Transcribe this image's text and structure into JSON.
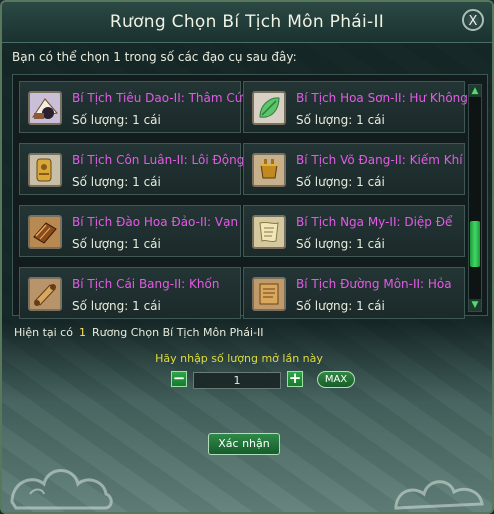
{
  "window": {
    "title": "Rương Chọn Bí Tịch Môn Phái-II",
    "close_label": "X"
  },
  "prompt": "Bạn có thể chọn 1 trong số các đạo cụ sau đây:",
  "items": [
    {
      "name": "Bí Tịch Tiêu Dao-II: Thâm Cứu",
      "qty": "Số lượng: 1 cái",
      "icon": "scroll-fan-icon"
    },
    {
      "name": "Bí Tịch Hoa Sơn-II: Hư Không",
      "qty": "Số lượng: 1 cái",
      "icon": "jade-leaf-icon"
    },
    {
      "name": "Bí Tịch Côn Luân-II: Lôi Động",
      "qty": "Số lượng: 1 cái",
      "icon": "golden-scroll-icon"
    },
    {
      "name": "Bí Tịch Võ Đang-II: Kiếm Khí",
      "qty": "Số lượng: 1 cái",
      "icon": "bronze-cauldron-icon"
    },
    {
      "name": "Bí Tịch Đào Hoa Đảo-II: Vạn",
      "qty": "Số lượng: 1 cái",
      "icon": "book-icon"
    },
    {
      "name": "Bí Tịch Nga My-II: Diệp Để",
      "qty": "Số lượng: 1 cái",
      "icon": "paper-scroll-icon"
    },
    {
      "name": "Bí Tịch Cái Bang-II: Khốn",
      "qty": "Số lượng: 1 cái",
      "icon": "rolled-scroll-icon"
    },
    {
      "name": "Bí Tịch Đường Môn-II: Hỏa",
      "qty": "Số lượng: 1 cái",
      "icon": "parchment-icon"
    }
  ],
  "status": {
    "prefix": "Hiện tại có",
    "count": "1",
    "item": "Rương Chọn Bí Tịch Môn Phái-II"
  },
  "quantity": {
    "label": "Hãy nhập số lượng mở lần này",
    "value": "1",
    "decrement": "−",
    "increment": "+",
    "max_label": "MAX"
  },
  "confirm_label": "Xác nhận",
  "scrollbar": {
    "up": "▲",
    "down": "▼",
    "position_fraction": 0.62
  },
  "colors": {
    "item_name": "#e45ae6",
    "highlight": "#ffe060",
    "label": "#dedc3c",
    "button": "#2f8a48"
  }
}
